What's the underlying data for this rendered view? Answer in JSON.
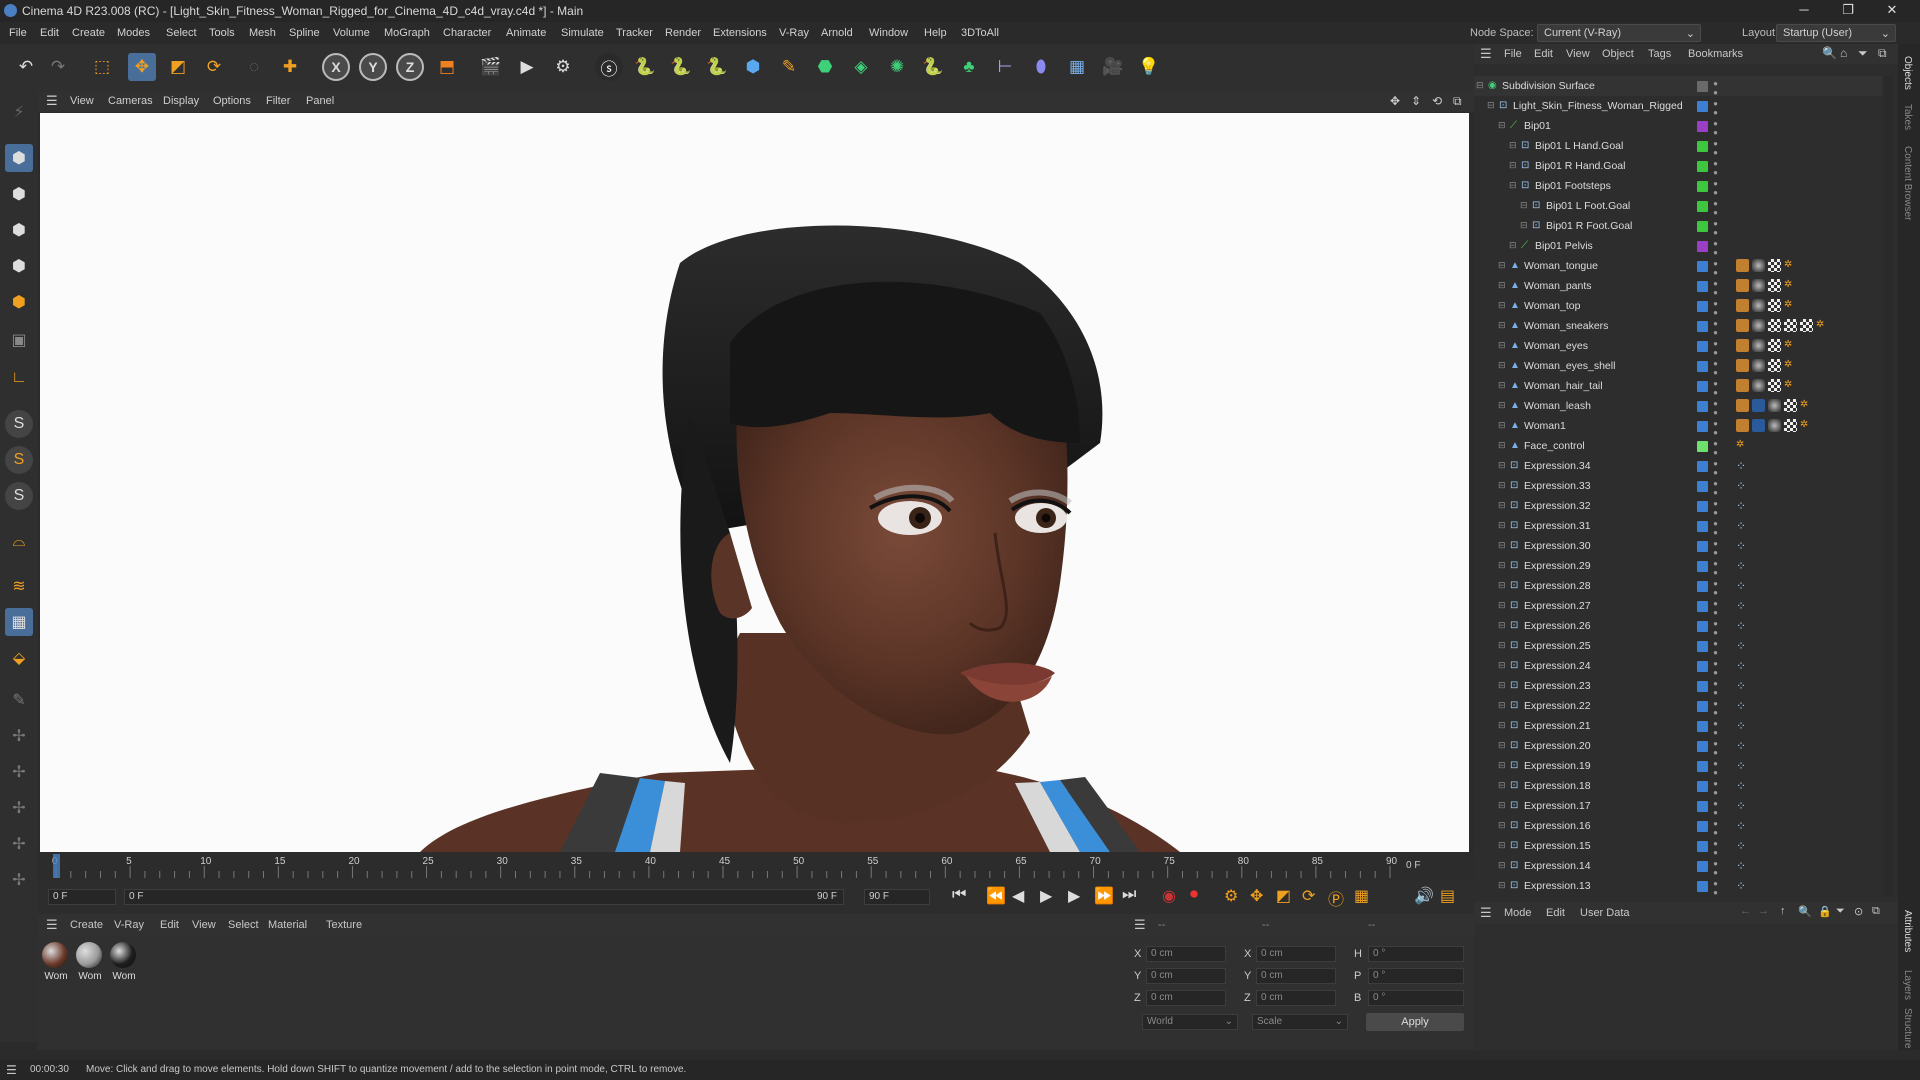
{
  "window": {
    "title": "Cinema 4D R23.008 (RC) - [Light_Skin_Fitness_Woman_Rigged_for_Cinema_4D_c4d_vray.c4d *] - Main",
    "minimize": "─",
    "maximize": "❐",
    "close": "✕"
  },
  "menubar": {
    "items": [
      "File",
      "Edit",
      "Create",
      "Modes",
      "Select",
      "Tools",
      "Mesh",
      "Spline",
      "Volume",
      "MoGraph",
      "Character",
      "Animate",
      "Simulate",
      "Tracker",
      "Render",
      "Extensions",
      "V-Ray",
      "Arnold",
      "Window",
      "Help",
      "3DToAll"
    ],
    "node_space_label": "Node Space:",
    "node_space_value": "Current (V-Ray)",
    "layout_label": "Layout:",
    "layout_value": "Startup (User)"
  },
  "viewport_menu": [
    "View",
    "Cameras",
    "Display",
    "Options",
    "Filter",
    "Panel"
  ],
  "timeline": {
    "ticks": [
      "0",
      "5",
      "10",
      "15",
      "20",
      "25",
      "30",
      "35",
      "40",
      "45",
      "50",
      "55",
      "60",
      "65",
      "70",
      "75",
      "80",
      "85",
      "90"
    ],
    "current_frame": "0 F",
    "start_field": "0 F",
    "range_start": "0 F",
    "range_end": "90 F",
    "end_field": "90 F",
    "playhead_frame": 0,
    "max_frame": 90
  },
  "material_panel": {
    "menu": [
      "Create",
      "V-Ray",
      "Edit",
      "View",
      "Select",
      "Material",
      "Texture"
    ],
    "materials": [
      {
        "label": "Wom",
        "color": "#6b3a2a"
      },
      {
        "label": "Wom",
        "color": "#9a9a9a"
      },
      {
        "label": "Wom",
        "color": "#1d1d1d"
      }
    ]
  },
  "coord_panel": {
    "header": [
      "--",
      "--",
      "--"
    ],
    "rows": [
      {
        "a": "X",
        "av": "0 cm",
        "b": "X",
        "bv": "0 cm",
        "c": "H",
        "cv": "0 °"
      },
      {
        "a": "Y",
        "av": "0 cm",
        "b": "Y",
        "bv": "0 cm",
        "c": "P",
        "cv": "0 °"
      },
      {
        "a": "Z",
        "av": "0 cm",
        "b": "Z",
        "bv": "0 cm",
        "c": "B",
        "cv": "0 °"
      }
    ],
    "world": "World",
    "scale": "Scale",
    "apply": "Apply"
  },
  "object_panel": {
    "menu": [
      "File",
      "Edit",
      "View",
      "Object",
      "Tags",
      "Bookmarks"
    ],
    "objects": [
      {
        "name": "Subdivision Surface",
        "depth": 0,
        "icon": "subdivision-icon",
        "color": "#6a6a6a",
        "tags": []
      },
      {
        "name": "Light_Skin_Fitness_Woman_Rigged",
        "depth": 1,
        "icon": "null-icon",
        "color": "#3d7fd1",
        "tags": []
      },
      {
        "name": "Bip01",
        "depth": 2,
        "icon": "bone-icon",
        "color": "#9b3fc6",
        "tags": []
      },
      {
        "name": "Bip01 L Hand.Goal",
        "depth": 3,
        "icon": "null-icon",
        "color": "#3fc63f",
        "tags": []
      },
      {
        "name": "Bip01 R Hand.Goal",
        "depth": 3,
        "icon": "null-icon",
        "color": "#3fc63f",
        "tags": []
      },
      {
        "name": "Bip01 Footsteps",
        "depth": 3,
        "icon": "null-icon",
        "color": "#3fc63f",
        "tags": []
      },
      {
        "name": "Bip01 L Foot.Goal",
        "depth": 4,
        "icon": "null-icon",
        "color": "#3fc63f",
        "tags": []
      },
      {
        "name": "Bip01 R Foot.Goal",
        "depth": 4,
        "icon": "null-icon",
        "color": "#3fc63f",
        "tags": []
      },
      {
        "name": "Bip01 Pelvis",
        "depth": 3,
        "icon": "bone-icon",
        "color": "#9b3fc6",
        "tags": []
      },
      {
        "name": "Woman_tongue",
        "depth": 2,
        "icon": "polygon-icon",
        "color": "#3d7fd1",
        "tags": [
          "skin",
          "mat",
          "check",
          "dots"
        ]
      },
      {
        "name": "Woman_pants",
        "depth": 2,
        "icon": "polygon-icon",
        "color": "#3d7fd1",
        "tags": [
          "skin",
          "mat",
          "check",
          "dots"
        ]
      },
      {
        "name": "Woman_top",
        "depth": 2,
        "icon": "polygon-icon",
        "color": "#3d7fd1",
        "tags": [
          "skin",
          "mat",
          "check",
          "dots"
        ]
      },
      {
        "name": "Woman_sneakers",
        "depth": 2,
        "icon": "polygon-icon",
        "color": "#3d7fd1",
        "tags": [
          "skin",
          "mat",
          "check",
          "check",
          "check",
          "dots"
        ]
      },
      {
        "name": "Woman_eyes",
        "depth": 2,
        "icon": "polygon-icon",
        "color": "#3d7fd1",
        "tags": [
          "skin",
          "mat",
          "check",
          "dots"
        ]
      },
      {
        "name": "Woman_eyes_shell",
        "depth": 2,
        "icon": "polygon-icon",
        "color": "#3d7fd1",
        "tags": [
          "skin",
          "mat",
          "check",
          "dots"
        ]
      },
      {
        "name": "Woman_hair_tail",
        "depth": 2,
        "icon": "polygon-icon",
        "color": "#3d7fd1",
        "tags": [
          "skin",
          "mat",
          "check",
          "dots"
        ]
      },
      {
        "name": "Woman_leash",
        "depth": 2,
        "icon": "polygon-icon",
        "color": "#3d7fd1",
        "tags": [
          "skin",
          "morph",
          "mat",
          "check",
          "dots"
        ]
      },
      {
        "name": "Woman1",
        "depth": 2,
        "icon": "polygon-icon",
        "color": "#3d7fd1",
        "tags": [
          "skin",
          "morph",
          "mat",
          "check",
          "dots"
        ]
      },
      {
        "name": "Face_control",
        "depth": 2,
        "icon": "polygon-icon",
        "color": "#6ee06e",
        "tags": [
          "dots"
        ]
      },
      {
        "name": "Expression.34",
        "depth": 2,
        "icon": "null-icon",
        "color": "#3d7fd1",
        "tags": [
          "xpresso"
        ]
      },
      {
        "name": "Expression.33",
        "depth": 2,
        "icon": "null-icon",
        "color": "#3d7fd1",
        "tags": [
          "xpresso"
        ]
      },
      {
        "name": "Expression.32",
        "depth": 2,
        "icon": "null-icon",
        "color": "#3d7fd1",
        "tags": [
          "xpresso"
        ]
      },
      {
        "name": "Expression.31",
        "depth": 2,
        "icon": "null-icon",
        "color": "#3d7fd1",
        "tags": [
          "xpresso"
        ]
      },
      {
        "name": "Expression.30",
        "depth": 2,
        "icon": "null-icon",
        "color": "#3d7fd1",
        "tags": [
          "xpresso"
        ]
      },
      {
        "name": "Expression.29",
        "depth": 2,
        "icon": "null-icon",
        "color": "#3d7fd1",
        "tags": [
          "xpresso"
        ]
      },
      {
        "name": "Expression.28",
        "depth": 2,
        "icon": "null-icon",
        "color": "#3d7fd1",
        "tags": [
          "xpresso"
        ]
      },
      {
        "name": "Expression.27",
        "depth": 2,
        "icon": "null-icon",
        "color": "#3d7fd1",
        "tags": [
          "xpresso"
        ]
      },
      {
        "name": "Expression.26",
        "depth": 2,
        "icon": "null-icon",
        "color": "#3d7fd1",
        "tags": [
          "xpresso"
        ]
      },
      {
        "name": "Expression.25",
        "depth": 2,
        "icon": "null-icon",
        "color": "#3d7fd1",
        "tags": [
          "xpresso"
        ]
      },
      {
        "name": "Expression.24",
        "depth": 2,
        "icon": "null-icon",
        "color": "#3d7fd1",
        "tags": [
          "xpresso"
        ]
      },
      {
        "name": "Expression.23",
        "depth": 2,
        "icon": "null-icon",
        "color": "#3d7fd1",
        "tags": [
          "xpresso"
        ]
      },
      {
        "name": "Expression.22",
        "depth": 2,
        "icon": "null-icon",
        "color": "#3d7fd1",
        "tags": [
          "xpresso"
        ]
      },
      {
        "name": "Expression.21",
        "depth": 2,
        "icon": "null-icon",
        "color": "#3d7fd1",
        "tags": [
          "xpresso"
        ]
      },
      {
        "name": "Expression.20",
        "depth": 2,
        "icon": "null-icon",
        "color": "#3d7fd1",
        "tags": [
          "xpresso"
        ]
      },
      {
        "name": "Expression.19",
        "depth": 2,
        "icon": "null-icon",
        "color": "#3d7fd1",
        "tags": [
          "xpresso"
        ]
      },
      {
        "name": "Expression.18",
        "depth": 2,
        "icon": "null-icon",
        "color": "#3d7fd1",
        "tags": [
          "xpresso"
        ]
      },
      {
        "name": "Expression.17",
        "depth": 2,
        "icon": "null-icon",
        "color": "#3d7fd1",
        "tags": [
          "xpresso"
        ]
      },
      {
        "name": "Expression.16",
        "depth": 2,
        "icon": "null-icon",
        "color": "#3d7fd1",
        "tags": [
          "xpresso"
        ]
      },
      {
        "name": "Expression.15",
        "depth": 2,
        "icon": "null-icon",
        "color": "#3d7fd1",
        "tags": [
          "xpresso"
        ]
      },
      {
        "name": "Expression.14",
        "depth": 2,
        "icon": "null-icon",
        "color": "#3d7fd1",
        "tags": [
          "xpresso"
        ]
      },
      {
        "name": "Expression.13",
        "depth": 2,
        "icon": "null-icon",
        "color": "#3d7fd1",
        "tags": [
          "xpresso"
        ]
      }
    ]
  },
  "attr_panel": {
    "menu": [
      "Mode",
      "Edit",
      "User Data"
    ]
  },
  "right_strip": [
    "Objects",
    "Takes",
    "Content Browser",
    "Attributes",
    "Layers",
    "Structure"
  ],
  "status": {
    "time": "00:00:30",
    "message": "Move: Click and drag to move elements. Hold down SHIFT to quantize movement / add to the selection in point mode, CTRL to remove."
  },
  "colors": {
    "accent": "#3d7fd1",
    "viewport_bg": "#fbfbfb",
    "active_tool": "#4a6e9a"
  }
}
